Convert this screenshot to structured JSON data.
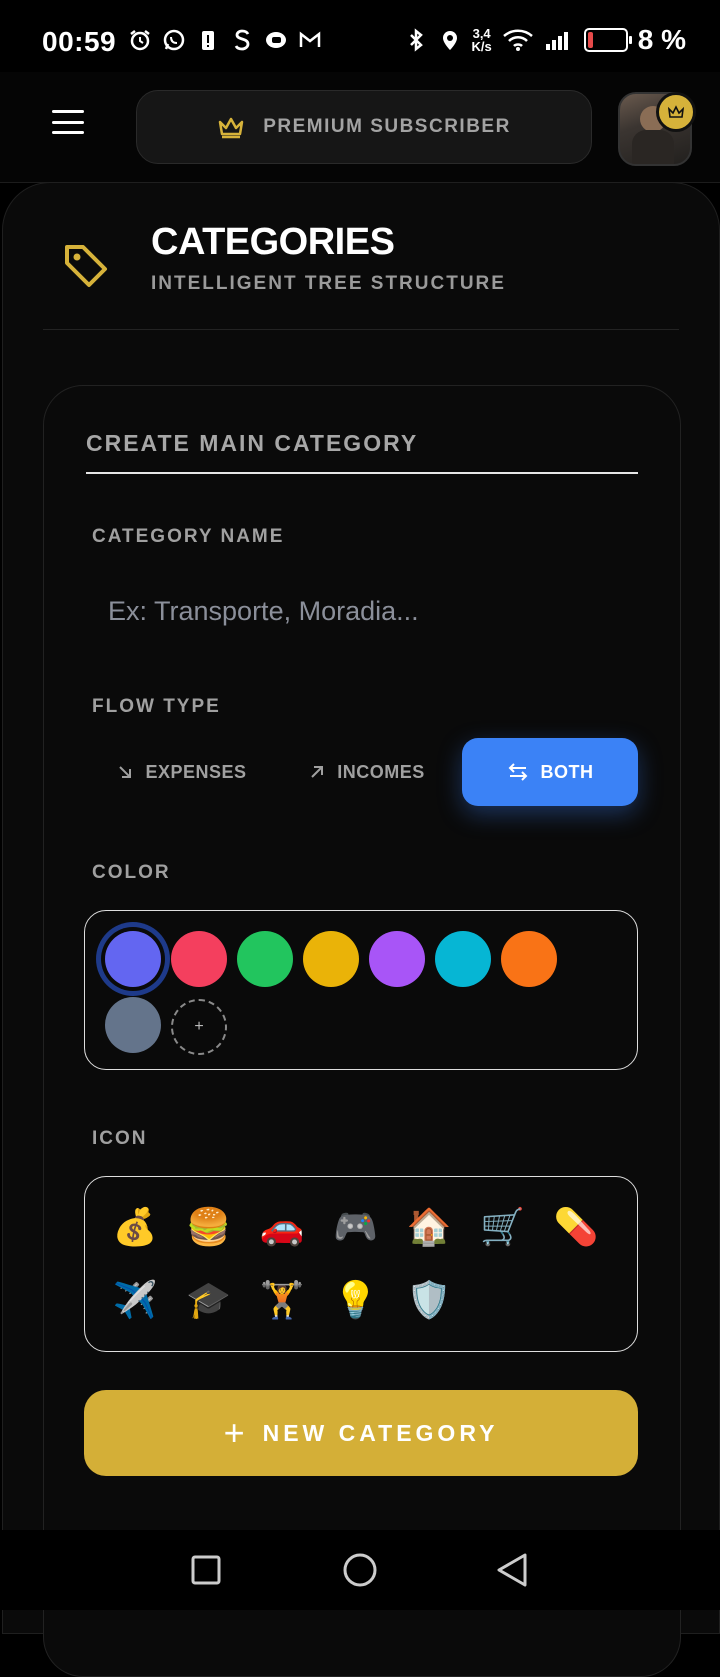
{
  "status_bar": {
    "time": "00:59",
    "network_speed_value": "3,4",
    "network_speed_unit": "K/s",
    "battery_percent": "8 %",
    "battery_level": 0.08
  },
  "header": {
    "premium_label": "PREMIUM SUBSCRIBER"
  },
  "page": {
    "title": "CATEGORIES",
    "subtitle": "INTELLIGENT TREE STRUCTURE"
  },
  "form": {
    "section_title": "CREATE MAIN CATEGORY",
    "name_label": "CATEGORY NAME",
    "name_placeholder": "Ex: Transporte, Moradia...",
    "name_value": "",
    "flow_label": "FLOW TYPE",
    "flow_options": [
      {
        "label": "EXPENSES",
        "icon": "arrow-down-right-icon",
        "selected": false
      },
      {
        "label": "INCOMES",
        "icon": "arrow-up-right-icon",
        "selected": false
      },
      {
        "label": "BOTH",
        "icon": "swap-arrows-icon",
        "selected": true
      }
    ],
    "color_label": "COLOR",
    "colors": [
      "#6366f1",
      "#f43f5e",
      "#22c55e",
      "#eab308",
      "#a855f7",
      "#06b6d4",
      "#f97316",
      "#64748b"
    ],
    "selected_color": "#6366f1",
    "add_color_symbol": "+",
    "icon_label": "ICON",
    "icons": [
      "💰",
      "🍔",
      "🚗",
      "🎮",
      "🏠",
      "🛒",
      "💊",
      "✈️",
      "🎓",
      "🏋️",
      "💡",
      "🛡️"
    ],
    "submit_label": "NEW CATEGORY",
    "submit_icon": "+"
  },
  "colors": {
    "accent_gold": "#d4af37",
    "accent_blue": "#3b82f6",
    "background": "#0a0a0a"
  }
}
